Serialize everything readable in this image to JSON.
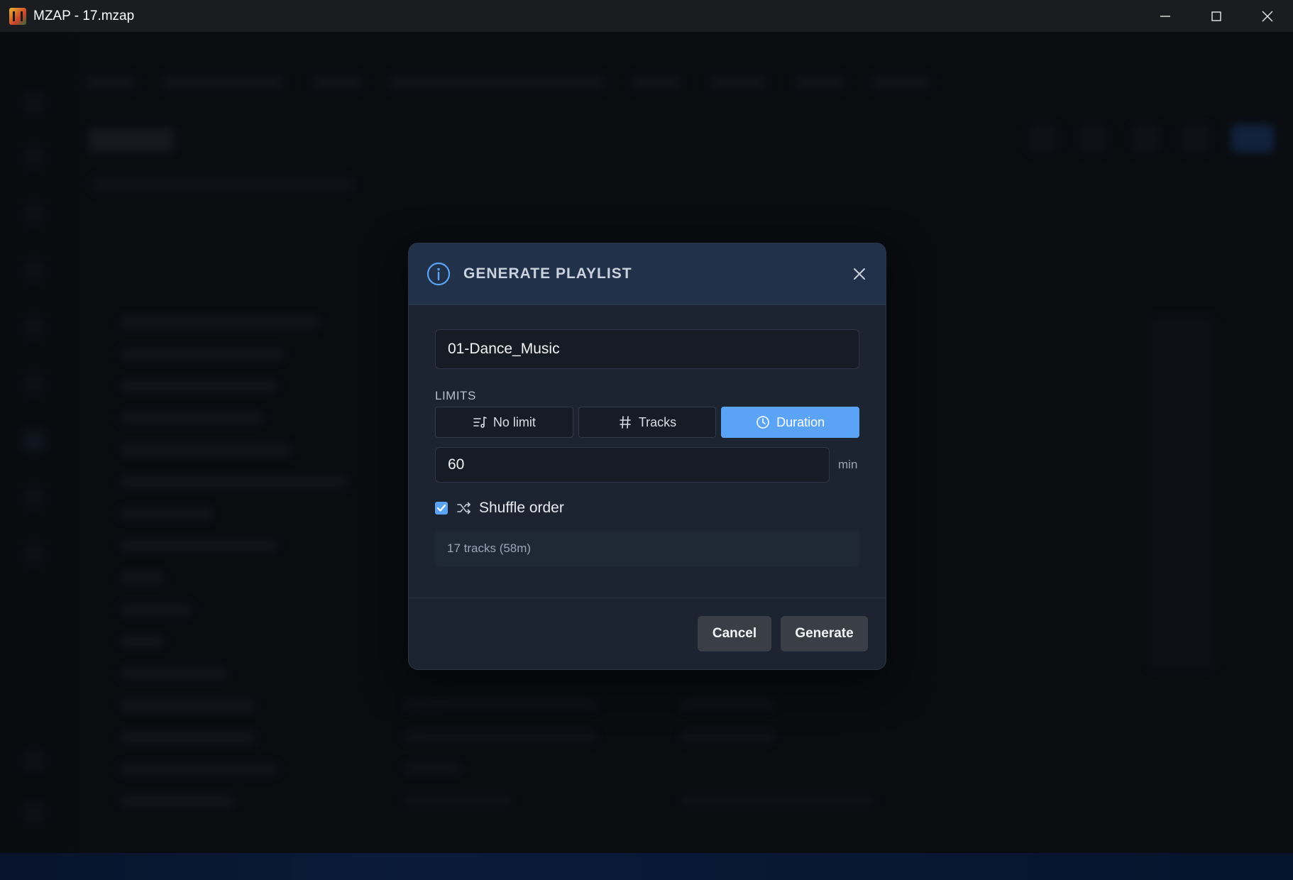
{
  "window": {
    "title": "MZAP - 17.mzap",
    "controls": {
      "minimize_icon": "minimize-icon",
      "maximize_icon": "maximize-icon",
      "close_icon": "close-icon"
    }
  },
  "dialog": {
    "title": "GENERATE PLAYLIST",
    "header_icon": "info-icon",
    "playlist_name": "01-Dance_Music",
    "limits_label": "LIMITS",
    "limit_options": [
      {
        "label": "No limit",
        "icon": "playlist-icon",
        "selected": false
      },
      {
        "label": "Tracks",
        "icon": "hash-icon",
        "selected": false
      },
      {
        "label": "Duration",
        "icon": "clock-icon",
        "selected": true
      }
    ],
    "duration_value": "60",
    "duration_unit": "min",
    "shuffle": {
      "checked": true,
      "label": "Shuffle order",
      "icon": "shuffle-icon"
    },
    "summary": "17 tracks (58m)",
    "buttons": {
      "cancel": "Cancel",
      "generate": "Generate"
    }
  },
  "colors": {
    "accent": "#5aa3f5",
    "dialog_bg": "#1c2431",
    "header_bg": "#22314a",
    "status_bar": "#143b86"
  }
}
